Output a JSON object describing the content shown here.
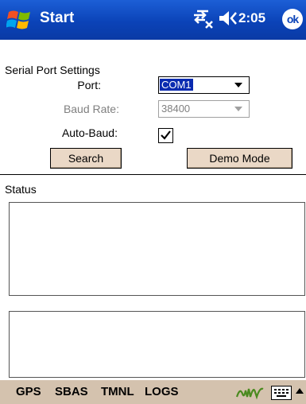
{
  "titlebar": {
    "title": "Start",
    "time": "2:05",
    "ok_label": "ok"
  },
  "settings": {
    "group_label": "Serial Port Settings",
    "port_label": "Port:",
    "port_value": "COM1",
    "baud_label": "Baud Rate:",
    "baud_value": "38400",
    "autobaud_label": "Auto-Baud:",
    "autobaud_checked": true,
    "search_button": "Search",
    "demo_button": "Demo Mode"
  },
  "status": {
    "label": "Status"
  },
  "menubar": {
    "items": [
      "GPS",
      "SBAS",
      "TMNL",
      "LOGS"
    ]
  },
  "colors": {
    "titlebar": "#0b43b8",
    "menubar": "#d4c2ae",
    "button": "#ead8c6",
    "selection": "#0a2bb0"
  },
  "icons": [
    "windows-start-icon",
    "connectivity-icon",
    "volume-icon",
    "ok-icon",
    "input-panel-icon",
    "keyboard-icon",
    "up-arrow-icon"
  ]
}
